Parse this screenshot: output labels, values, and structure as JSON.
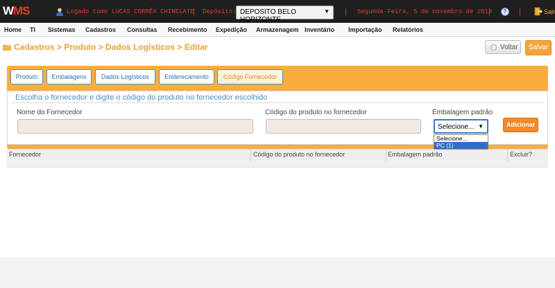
{
  "app": {
    "logo_w": "W",
    "logo_ms": "MS",
    "user_text": "Logado como LUCAS CORRÊA CHINELATE",
    "deposit_label": "Depósito:",
    "deposit_value": "DEPOSITO BELO HORIZONTE",
    "date_text": "Segunda-Feira, 5 de novembro de 2018",
    "separator": "|",
    "exit_label": "Sair"
  },
  "menu": [
    "Home",
    "TI",
    "Sistemas",
    "Cadastros",
    "Consultas",
    "Recebimento",
    "Expedição",
    "Armazenagem",
    "Inventário",
    "Importação",
    "Relatórios"
  ],
  "breadcrumb": "Cadastros > Produto > Dados Logísticos > Editar",
  "actions": {
    "back_label": "Voltar",
    "save_label": "Salvar"
  },
  "tabs": [
    "Produto",
    "Embalagens",
    "Dados Logísticos",
    "Enderecamento",
    "Código Fornecedor"
  ],
  "form": {
    "title": "Escolha o fornecedor e digite o código do produto no fornecedor escolhido",
    "supplier_label": "Nome do Fornecedor",
    "supplier_value": "",
    "code_label": "Código do produto no fornecedor",
    "code_value": "",
    "package_label": "Embalagem padrão",
    "package_value": "Selecione...",
    "package_options": [
      "Selecione...",
      "PC (1)"
    ],
    "add_label": "Adicionar"
  },
  "table": {
    "headers": [
      "Fornecedor",
      "Código do produto no fornecedor",
      "Embalagem padrão",
      "Excluir?"
    ]
  }
}
